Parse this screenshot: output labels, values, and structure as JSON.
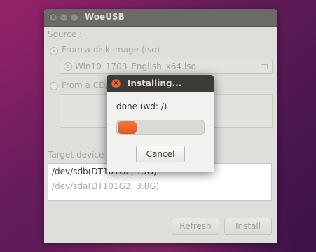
{
  "main_window": {
    "title": "WoeUSB",
    "source_label": "Source :",
    "option_iso_label": "From a disk image (iso)",
    "iso_path": "Win10_1703_English_x64.iso",
    "option_cd_label": "From a CD/",
    "target_label": "Target device :",
    "devices": [
      {
        "label": "/dev/sdb(DT101G2,  15G)"
      },
      {
        "label": "/dev/sda(DT101G2,  3.8G)"
      }
    ],
    "refresh_label": "Refresh",
    "install_label": "Install"
  },
  "dialog": {
    "title": "Installing...",
    "status": "done (wd: /)",
    "progress": 0.22,
    "cancel_label": "Cancel"
  },
  "colors": {
    "accent": "#e96230",
    "desktop": "#6a1d5e",
    "titlebar_dark": "#3c3b37"
  }
}
